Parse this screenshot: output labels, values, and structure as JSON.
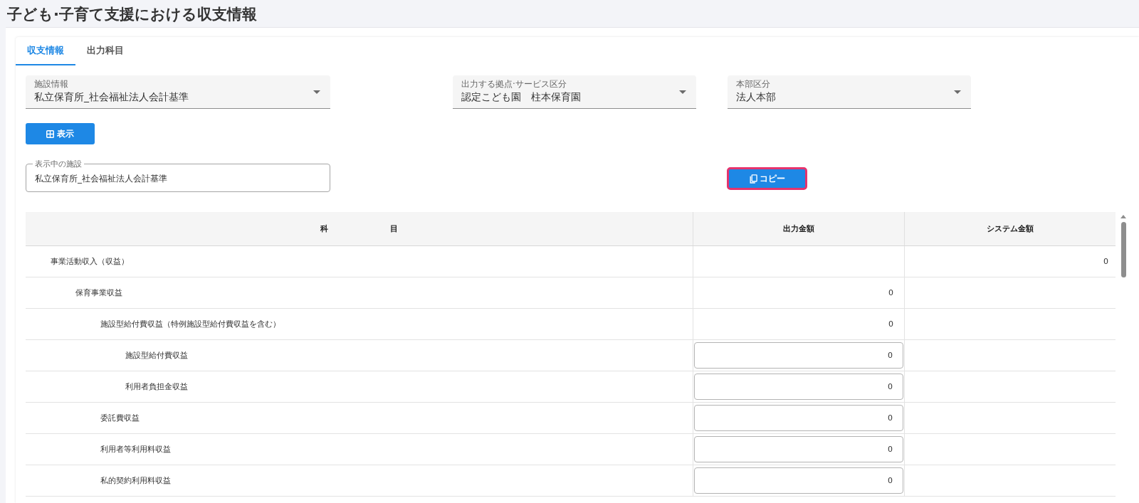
{
  "page_title": "子ども·子育て支援における収支情報",
  "tabs": [
    {
      "label": "収支情報",
      "selected": true
    },
    {
      "label": "出力科目",
      "selected": false
    }
  ],
  "selects": [
    {
      "label": "施設情報",
      "value": "私立保育所_社会福祉法人会計基準"
    },
    {
      "label": "出力する拠点·サービス区分",
      "value": "認定こども園　柱本保育園"
    },
    {
      "label": "本部区分",
      "value": "法人本部"
    }
  ],
  "show_button": {
    "label": "表示"
  },
  "displayed_facility": {
    "label": "表示中の施設",
    "value": "私立保育所_社会福祉法人会計基準"
  },
  "copy_button": {
    "label": "コピー",
    "highlighted": true
  },
  "table": {
    "columns": [
      "科 目",
      "出力金額",
      "システム金額"
    ],
    "rows": [
      {
        "label": "事業活動収入（収益）",
        "system_amount": "0",
        "children": [
          {
            "label": "保育事業収益",
            "output_amount": {
              "kind": "text",
              "value": "0"
            },
            "children": [
              {
                "label": "施設型給付費収益（特例施設型給付費収益を含む）",
                "output_amount": {
                  "kind": "text",
                  "value": "0"
                },
                "children": [
                  {
                    "label": "施設型給付費収益",
                    "output_amount": {
                      "kind": "input",
                      "value": "0"
                    }
                  },
                  {
                    "label": "利用者負担金収益",
                    "output_amount": {
                      "kind": "input",
                      "value": "0"
                    }
                  }
                ]
              },
              {
                "label": "委託費収益",
                "output_amount": {
                  "kind": "input",
                  "value": "0"
                }
              },
              {
                "label": "利用者等利用料収益",
                "output_amount": {
                  "kind": "input",
                  "value": "0"
                }
              },
              {
                "label": "私的契約利用料収益",
                "output_amount": {
                  "kind": "input",
                  "value": "0"
                }
              }
            ]
          }
        ]
      }
    ]
  }
}
